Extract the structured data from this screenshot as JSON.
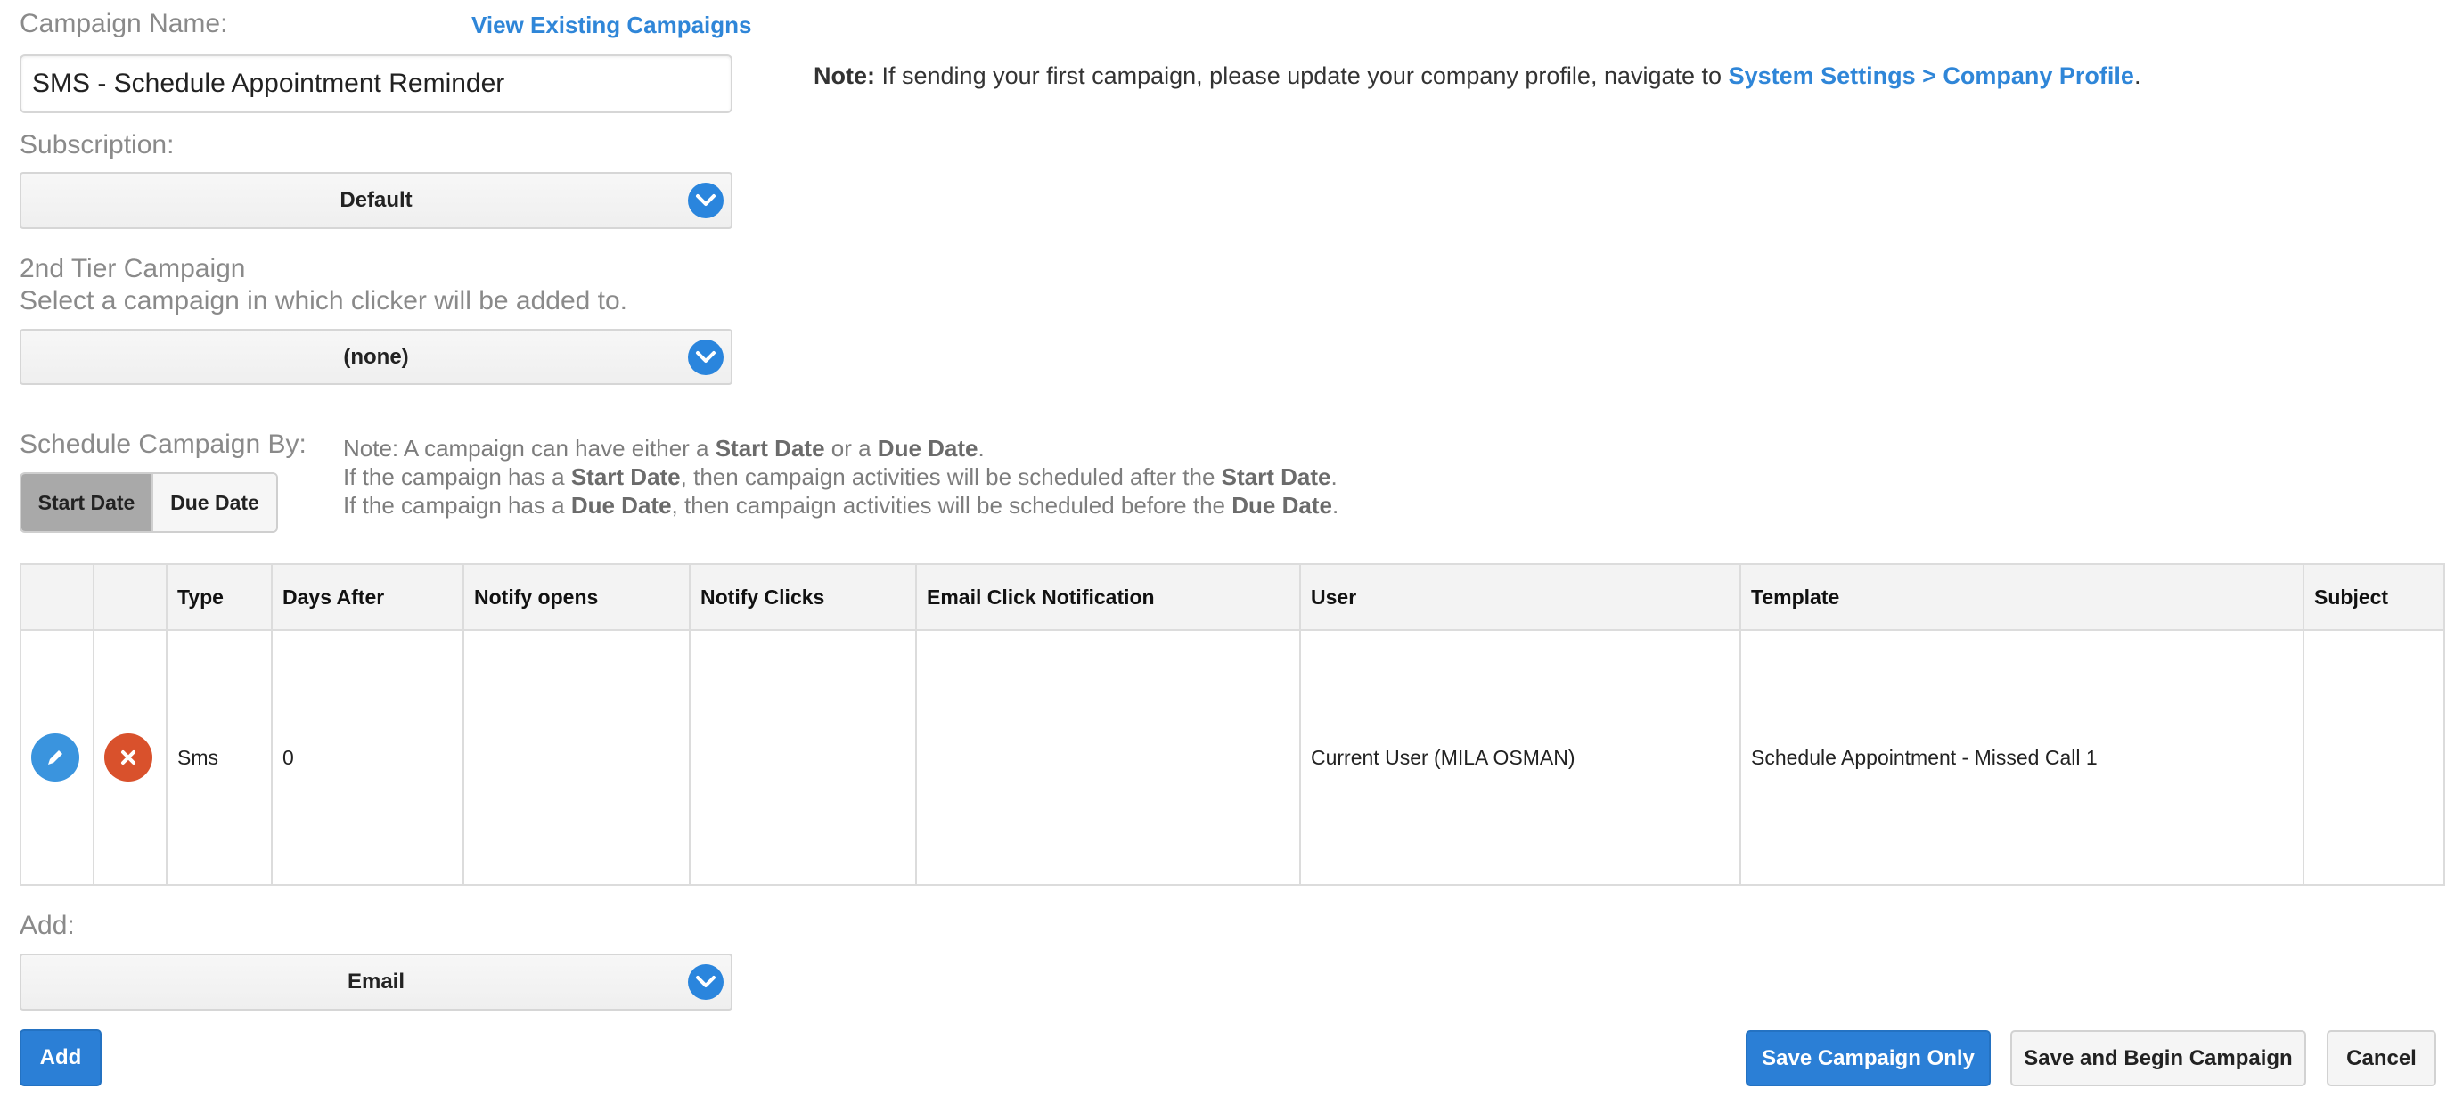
{
  "campaign_name": {
    "label": "Campaign Name:",
    "value": "SMS - Schedule Appointment Reminder",
    "view_existing_link": "View Existing Campaigns"
  },
  "top_note": {
    "prefix": "Note:",
    "text": " If sending your first campaign, please update your company profile, navigate to ",
    "link": "System Settings > Company Profile",
    "suffix": "."
  },
  "subscription": {
    "label": "Subscription:",
    "selected": "Default"
  },
  "tier2": {
    "title": "2nd Tier Campaign",
    "subtitle": "Select a campaign in which clicker will be added to.",
    "selected": "(none)"
  },
  "schedule": {
    "label": "Schedule Campaign By:",
    "options": [
      "Start Date",
      "Due Date"
    ],
    "active": "Start Date",
    "note": {
      "l1_a": "Note: A campaign can have either a ",
      "l1_b": "Start Date",
      "l1_c": " or a ",
      "l1_d": "Due Date",
      "l1_e": ".",
      "l2_a": "If the campaign has a ",
      "l2_b": "Start Date",
      "l2_c": ", then campaign activities will be scheduled after the ",
      "l2_d": "Start Date",
      "l2_e": ".",
      "l3_a": "If the campaign has a ",
      "l3_b": "Due Date",
      "l3_c": ", then campaign activities will be scheduled before the ",
      "l3_d": "Due Date",
      "l3_e": "."
    }
  },
  "table": {
    "headers": [
      "",
      "",
      "Type",
      "Days After",
      "Notify opens",
      "Notify Clicks",
      "Email Click Notification",
      "User",
      "Template",
      "Subject"
    ],
    "rows": [
      {
        "type": "Sms",
        "days_after": "0",
        "notify_opens": "",
        "notify_clicks": "",
        "email_click_notification": "",
        "user": "Current User (MILA OSMAN)",
        "template": "Schedule Appointment - Missed Call 1",
        "subject": ""
      }
    ]
  },
  "add": {
    "label": "Add:",
    "selected": "Email",
    "button": "Add"
  },
  "actions": {
    "save_only": "Save Campaign Only",
    "save_begin": "Save and Begin Campaign",
    "cancel": "Cancel"
  },
  "colors": {
    "accent": "#2b7fd6",
    "danger": "#d9512c",
    "edit": "#3a94de"
  },
  "icons": [
    "chevron-down-icon",
    "pencil-icon",
    "close-icon"
  ]
}
